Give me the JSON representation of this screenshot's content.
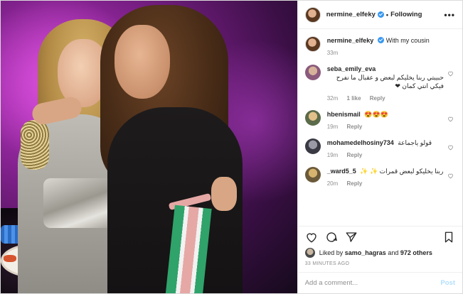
{
  "post": {
    "author": "nermine_elfeky",
    "follow_status": "Following",
    "more_label": "•••",
    "caption": {
      "user": "nermine_elfeky",
      "text": "With my cousin",
      "age": "33m"
    }
  },
  "comments": [
    {
      "user": "seba_emily_eva",
      "text": "حبيبتي ربنا يخليكم لبعض و عقبال ما نفرح فيكي انتي كمان ❤",
      "age": "32m",
      "likes": "1 like",
      "reply": "Reply",
      "avatar_color": "#8b5a7c"
    },
    {
      "user": "hbenismail",
      "text": "😍😍😍",
      "age": "19m",
      "likes": "",
      "reply": "Reply",
      "avatar_color": "#5c6b4a"
    },
    {
      "user": "mohamedelhosiny734",
      "text": "قولو ياجماعة",
      "age": "19m",
      "likes": "",
      "reply": "Reply",
      "avatar_color": "#3a3a44"
    },
    {
      "user": "_ward5_5",
      "text": "ربنا يخليكو لبعض قمرات ✨ ✨",
      "age": "20m",
      "likes": "",
      "reply": "Reply",
      "avatar_color": "#6b5a3a"
    }
  ],
  "likes_line": {
    "prefix": "Liked by",
    "user": "samo_hagras",
    "connector": "and",
    "count": "972 others"
  },
  "timestamp": "33 MINUTES AGO",
  "add_comment": {
    "placeholder": "Add a comment...",
    "post_label": "Post"
  },
  "icons": {
    "like": "heart-icon",
    "comment": "comment-icon",
    "share": "share-icon",
    "save": "bookmark-icon",
    "verified": "verified-badge-icon"
  },
  "colors": {
    "verified": "#3897f0",
    "post_button_disabled": "#b2dffc",
    "meta_gray": "#8e8e8e"
  }
}
